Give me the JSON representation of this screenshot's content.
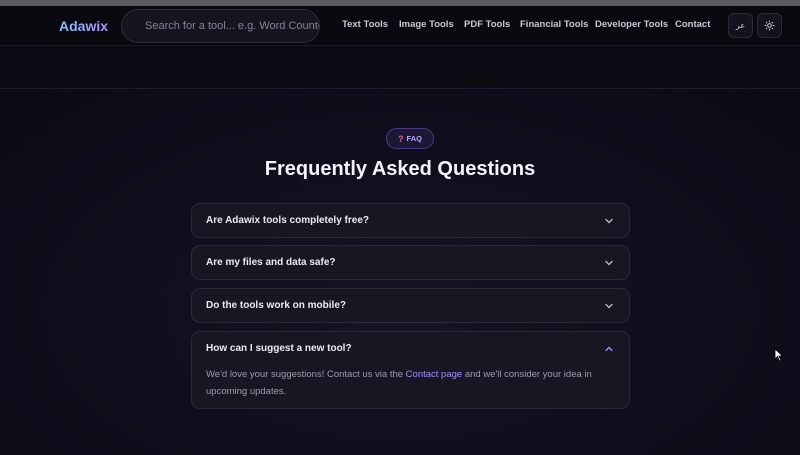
{
  "header": {
    "logo": "Adawix",
    "search_placeholder": "Search for a tool... e.g. Word Counter",
    "nav": [
      "Text Tools",
      "Image Tools",
      "PDF Tools",
      "Financial Tools",
      "Developer Tools",
      "Contact"
    ],
    "lang_button": "عر",
    "theme_icon": "sun-icon"
  },
  "faq": {
    "badge": "FAQ",
    "badge_icon": "question-mark-icon",
    "title": "Frequently Asked Questions",
    "items": [
      {
        "question": "Are Adawix tools completely free?",
        "expanded": false
      },
      {
        "question": "Are my files and data safe?",
        "expanded": false
      },
      {
        "question": "Do the tools work on mobile?",
        "expanded": false
      },
      {
        "question": "How can I suggest a new tool?",
        "expanded": true,
        "answer_before": "We'd love your suggestions! Contact us via the ",
        "answer_link": "Contact page",
        "answer_after": " and we'll consider your idea in upcoming updates."
      }
    ]
  },
  "colors": {
    "accent": "#a48bff",
    "background": "#0d0b18",
    "card": "#181623"
  }
}
